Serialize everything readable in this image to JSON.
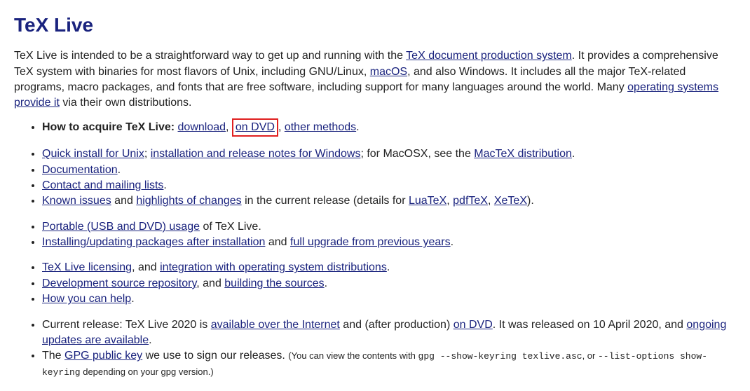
{
  "title": "TeX Live",
  "intro": {
    "t1": "TeX Live is intended to be a straightforward way to get up and running with the ",
    "link1": "TeX document production system",
    "t2": ". It provides a comprehensive TeX system with binaries for most flavors of Unix, including GNU/Linux, ",
    "link2": "macOS",
    "t3": ", and also Windows. It includes all the major TeX-related programs, macro packages, and fonts that are free software, including support for many languages around the world. Many ",
    "link3": "operating systems provide it",
    "t4": " via their own distributions."
  },
  "acquire": {
    "label": "How to acquire TeX Live: ",
    "download": "download",
    "sep1": ", ",
    "ondvd": "on DVD",
    "sep2": ", ",
    "other": "other methods",
    "end": "."
  },
  "quick": {
    "unix": "Quick install for Unix",
    "sep1": "; ",
    "win": "installation and release notes for Windows",
    "sep2": "; for MacOSX, see the ",
    "mac": "MacTeX distribution",
    "end": "."
  },
  "doc": {
    "link": "Documentation",
    "end": "."
  },
  "contact": {
    "link": "Contact and mailing lists",
    "end": "."
  },
  "issues": {
    "known": "Known issues",
    "t1": " and ",
    "high": "highlights of changes",
    "t2": " in the current release (details for ",
    "lua": "LuaTeX",
    "sep1": ", ",
    "pdf": "pdfTeX",
    "sep2": ", ",
    "xe": "XeTeX",
    "end": ")."
  },
  "portable": {
    "link": "Portable (USB and DVD) usage",
    "t": " of TeX Live."
  },
  "install": {
    "link1": "Installing/updating packages after installation",
    "t1": " and ",
    "link2": "full upgrade from previous years",
    "end": "."
  },
  "licensing": {
    "link1": "TeX Live licensing",
    "t1": ", and ",
    "link2": "integration with operating system distributions",
    "end": "."
  },
  "dev": {
    "link1": "Development source repository",
    "t1": ", and ",
    "link2": "building the sources",
    "end": "."
  },
  "help": {
    "link": "How you can help",
    "end": "."
  },
  "release": {
    "t1": "Current release: TeX Live 2020 is ",
    "link1": "available over the Internet",
    "t2": " and (after production) ",
    "link2": "on DVD",
    "t3": ". It was released on 10 April 2020, and ",
    "link3": "ongoing updates are available",
    "end": "."
  },
  "gpg": {
    "t1": "The ",
    "link": "GPG public key",
    "t2": " we use to sign our releases. ",
    "small1": "(You can view the contents with ",
    "code1": "gpg --show-keyring texlive.asc",
    "small2": ", or ",
    "code2": "--list-options show-keyring",
    "small3": " depending on your gpg version.)"
  }
}
